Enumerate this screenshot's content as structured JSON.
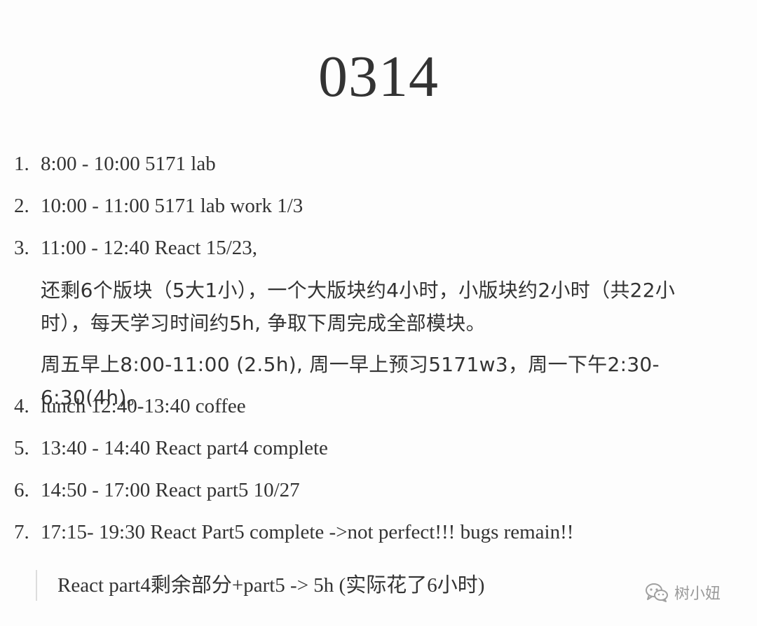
{
  "title": "0314",
  "items": [
    {
      "num": "1.",
      "text": "8:00 - 10:00 5171 lab"
    },
    {
      "num": "2.",
      "text": "10:00 - 11:00 5171 lab work 1/3"
    },
    {
      "num": "3.",
      "text": "11:00 - 12:40 React 15/23,"
    },
    {
      "num": "4.",
      "text": "lunch 12:40-13:40 coffee"
    },
    {
      "num": "5.",
      "text": "13:40 - 14:40 React part4 complete"
    },
    {
      "num": "6.",
      "text": "14:50 - 17:00 React part5 10/27"
    },
    {
      "num": "7.",
      "text": "17:15- 19:30 React Part5 complete ->not perfect!!! bugs remain!!"
    }
  ],
  "item3_notes": {
    "para1": "还剩6个版块（5大1小），一个大版块约4小时，小版块约2小时（共22小时），每天学习时间约5h, 争取下周完成全部模块。",
    "para2": "周五早上8:00-11:00 (2.5h), 周一早上预习5171w3，周一下午2:30-6:30(4h)。"
  },
  "quote": "React part4剩余部分+part5 -> 5h (实际花了6小时)",
  "watermark": {
    "text": "树小妞",
    "icon": "wechat-icon"
  }
}
